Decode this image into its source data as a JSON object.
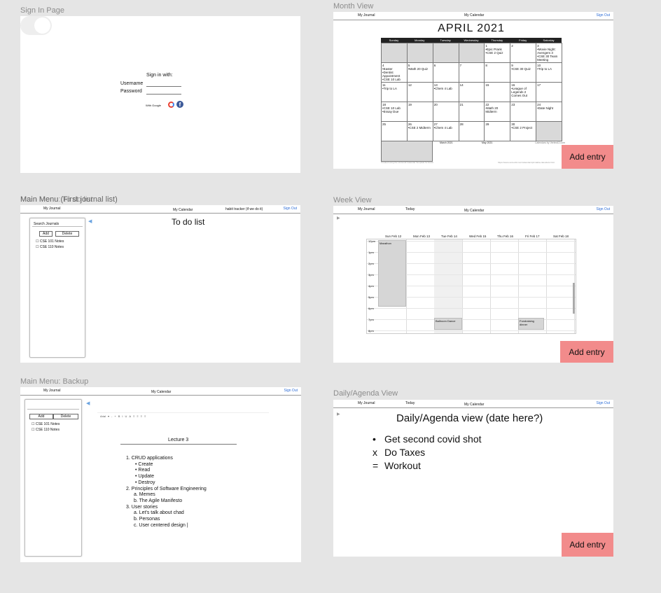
{
  "frames": {
    "signin_label": "Sign In Page",
    "month_label": "Month View",
    "mainmenu_label_a": "Main Menu (First journal list)",
    "mainmenu_label_b": "Main Menu: To do list",
    "week_label": "Week View",
    "backup_label": "Main Menu: Backup",
    "daily_label": "Daily/Agenda View"
  },
  "nav": {
    "my_journal": "My Journal",
    "my_calendar": "My Calendar",
    "sign_out": "Sign Out",
    "today": "Today",
    "habit_tracker": "habit tracker (if we do it)"
  },
  "signin": {
    "heading": "Sign in with:",
    "username_label": "Username",
    "password_label": "Password",
    "with_google": "With Google"
  },
  "add_entry": "Add entry",
  "month": {
    "title": "APRIL 2021",
    "days": [
      "Sunday",
      "Monday",
      "Tuesday",
      "Wednesday",
      "Thursday",
      "Friday",
      "Saturday"
    ],
    "weeks": [
      [
        {
          "n": "",
          "e": [],
          "g": true
        },
        {
          "n": "",
          "e": [],
          "g": true
        },
        {
          "n": "",
          "e": [],
          "g": true
        },
        {
          "n": "",
          "e": [],
          "g": true
        },
        {
          "n": "1",
          "e": [
            "•Epic Prank",
            "•CSE 2 Quiz"
          ]
        },
        {
          "n": "2",
          "e": []
        },
        {
          "n": "3",
          "e": [
            "•Movie Night: Avengers 3",
            "•CSE 30 Team Meeting"
          ]
        }
      ],
      [
        {
          "n": "4",
          "e": [
            "•Easter",
            "•Dentist Appointment",
            "•CSE 10 Lab"
          ]
        },
        {
          "n": "5",
          "e": [
            "•Math 20 Quiz"
          ]
        },
        {
          "n": "6",
          "e": []
        },
        {
          "n": "7",
          "e": []
        },
        {
          "n": "8",
          "e": []
        },
        {
          "n": "9",
          "e": [
            "•CSE 30 Quiz"
          ]
        },
        {
          "n": "10",
          "e": [
            "•Trip to LA"
          ]
        }
      ],
      [
        {
          "n": "11",
          "e": [
            "•Trip to LA"
          ]
        },
        {
          "n": "12",
          "e": []
        },
        {
          "n": "13",
          "e": [
            "•Chem 4 Lab"
          ]
        },
        {
          "n": "14",
          "e": []
        },
        {
          "n": "15",
          "e": []
        },
        {
          "n": "16",
          "e": [
            "•League of Legends 2 Comes Out"
          ]
        },
        {
          "n": "17",
          "e": []
        }
      ],
      [
        {
          "n": "18",
          "e": [
            "•CSE 10 Lab",
            "•Essay Due"
          ]
        },
        {
          "n": "19",
          "e": []
        },
        {
          "n": "20",
          "e": []
        },
        {
          "n": "21",
          "e": []
        },
        {
          "n": "22",
          "e": [
            "•Math 20 Midterm"
          ]
        },
        {
          "n": "23",
          "e": []
        },
        {
          "n": "24",
          "e": [
            "•Date Night"
          ]
        }
      ],
      [
        {
          "n": "25",
          "e": []
        },
        {
          "n": "26",
          "e": [
            "•CSE 2 Midterm"
          ]
        },
        {
          "n": "27",
          "e": [
            "•Chem 4 Lab"
          ]
        },
        {
          "n": "28",
          "e": []
        },
        {
          "n": "29",
          "e": []
        },
        {
          "n": "30",
          "e": [
            "•CSE 2 Project"
          ]
        },
        {
          "n": "",
          "e": [],
          "g": true
        }
      ]
    ],
    "mini_march": "March 2021",
    "mini_may": "May 2021",
    "credit_line": "Calendars by Vertex42.com",
    "footer_left": "Created using the Vertex42 Calendar Template for Excel",
    "footer_right": "https://www.vertex42.com/calendars/printable-calendars.html"
  },
  "todo": {
    "search": "Search Journals",
    "add": "Add",
    "delete": "Delete",
    "items": [
      "☐ CSE 101 Notes",
      "☐ CSE 110 Notes"
    ],
    "title": "To do list"
  },
  "week": {
    "days": [
      "Sun Feb 12",
      "Mon Feb 13",
      "Tue Feb 14",
      "Wed Feb 15",
      "Thu Feb 16",
      "Fri Feb 17",
      "Sat Feb 18"
    ],
    "hours": [
      "12pm",
      "1pm",
      "2pm",
      "3pm",
      "4pm",
      "5pm",
      "6pm",
      "7pm",
      "8pm"
    ],
    "events": [
      {
        "label": "Marathon"
      },
      {
        "label": "Ballroom Dance"
      },
      {
        "label": "Fundraising dinner"
      }
    ]
  },
  "backup": {
    "add": "Add",
    "delete": "Delete",
    "items": [
      "☐ CSE 101 Notes",
      "☐ CSE 110 Notes"
    ],
    "toolbar": [
      "Arial",
      "▾",
      "-",
      "+",
      "B",
      "I",
      "U",
      "A",
      "≡",
      "≡",
      "≡",
      "≡"
    ],
    "doc_title": "Lecture 3",
    "outline": [
      {
        "t": "1. CRUD applications",
        "lvl": 0
      },
      {
        "t": "• Create",
        "lvl": 2
      },
      {
        "t": "• Read",
        "lvl": 2
      },
      {
        "t": "• Update",
        "lvl": 2
      },
      {
        "t": "• Destroy",
        "lvl": 2
      },
      {
        "t": "2. Principles of Software Engineering",
        "lvl": 0
      },
      {
        "t": "a. Memes",
        "lvl": 1
      },
      {
        "t": "b. The Agile Manifesto",
        "lvl": 1
      },
      {
        "t": "3. User stories",
        "lvl": 0
      },
      {
        "t": "a. Let's talk about chad",
        "lvl": 1
      },
      {
        "t": "b. Personas",
        "lvl": 1
      },
      {
        "t": "c. User centered design |",
        "lvl": 1
      }
    ]
  },
  "daily": {
    "title": "Daily/Agenda view (date here?)",
    "items": [
      {
        "sym": "•",
        "text": "Get second covid shot"
      },
      {
        "sym": "x",
        "text": "Do Taxes"
      },
      {
        "sym": "=",
        "text": "Workout"
      }
    ]
  },
  "colors": {
    "accent": "#f28b8b",
    "link": "#2a6bd6",
    "bg": "#e5e5e5"
  }
}
